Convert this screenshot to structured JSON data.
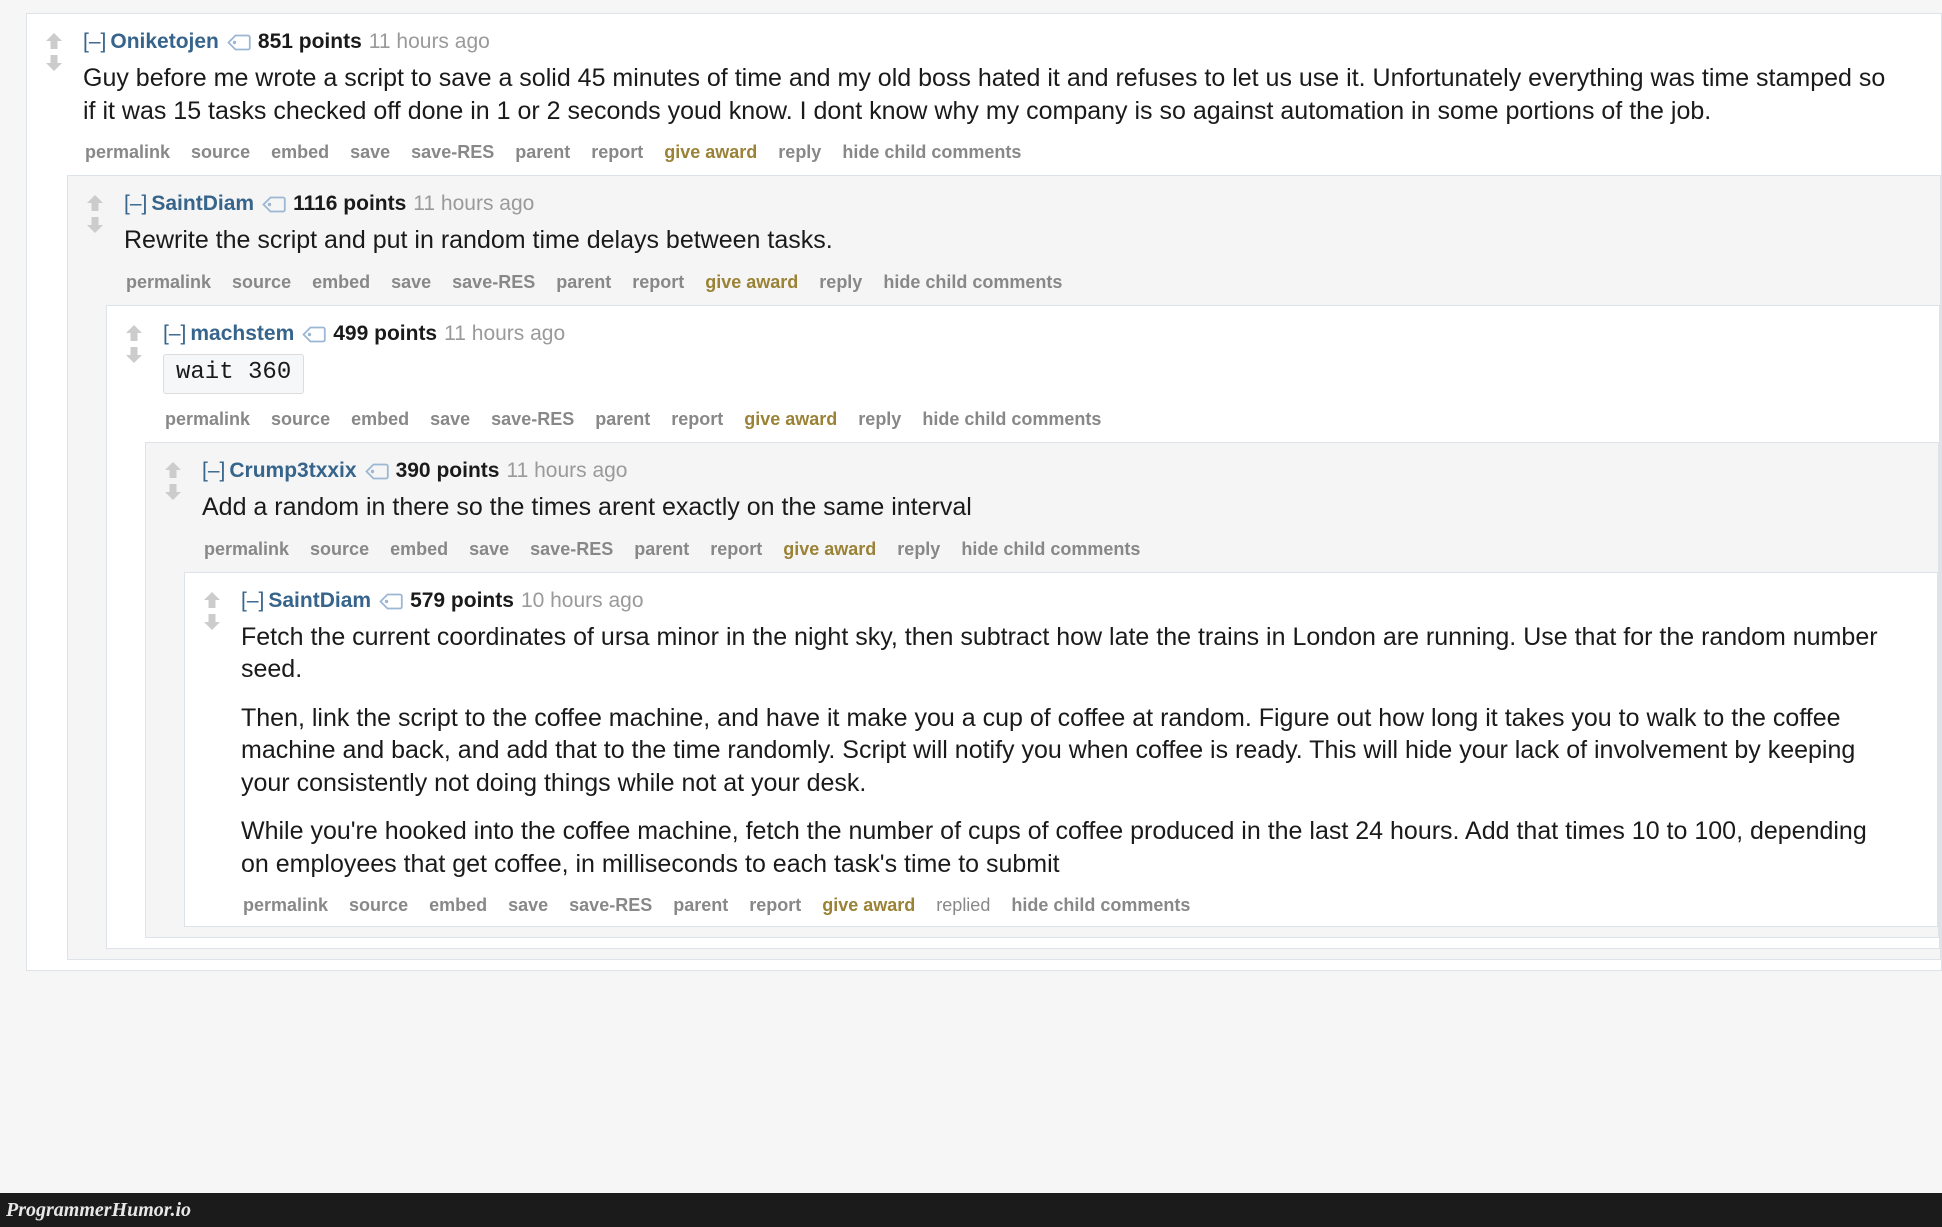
{
  "page": {
    "background": "#f6f6f6",
    "watermark": "ProgrammerHumor.io"
  },
  "colors": {
    "username": "#36648b",
    "points": "#1a1a1a",
    "age": "#9a9a9a",
    "action_link": "#888888",
    "give_award": "#9a8236",
    "border": "#dde3e8",
    "alt_background": "#f5f5f5",
    "code_background": "#f6f7f8",
    "arrow": "#cccccc",
    "tag_icon": "#9cb7d4"
  },
  "icons": {
    "upvote": "upvote-arrow-icon",
    "downvote": "downvote-arrow-icon",
    "tag": "comment-tag-icon",
    "collapse": "collapse-toggle-icon"
  },
  "action_labels": {
    "permalink": "permalink",
    "source": "source",
    "embed": "embed",
    "save": "save",
    "save_res": "save-RES",
    "parent": "parent",
    "report": "report",
    "give_award": "give award",
    "reply": "reply",
    "replied": "replied",
    "hide_child_comments": "hide child comments"
  },
  "comments": [
    {
      "level": 1,
      "collapse": "[–]",
      "username": "Oniketojen",
      "points": "851 points",
      "age": "11 hours ago",
      "paragraphs": [
        "Guy before me wrote a script to save a solid 45 minutes of time and my old boss hated it and refuses to let us use it. Unfortunately everything was time stamped so if it was 15 tasks checked off done in 1 or 2 seconds youd know. I dont know why my company is so against automation in some portions of the job."
      ],
      "code": null,
      "reply_label": "reply"
    },
    {
      "level": 2,
      "collapse": "[–]",
      "username": "SaintDiam",
      "points": "1116 points",
      "age": "11 hours ago",
      "paragraphs": [
        "Rewrite the script and put in random time delays between tasks."
      ],
      "code": null,
      "reply_label": "reply"
    },
    {
      "level": 3,
      "collapse": "[–]",
      "username": "machstem",
      "points": "499 points",
      "age": "11 hours ago",
      "paragraphs": [],
      "code": "wait 360",
      "reply_label": "reply"
    },
    {
      "level": 4,
      "collapse": "[–]",
      "username": "Crump3txxix",
      "points": "390 points",
      "age": "11 hours ago",
      "paragraphs": [
        "Add a random in there so the times arent exactly on the same interval"
      ],
      "code": null,
      "reply_label": "reply"
    },
    {
      "level": 5,
      "collapse": "[–]",
      "username": "SaintDiam",
      "points": "579 points",
      "age": "10 hours ago",
      "paragraphs": [
        "Fetch the current coordinates of ursa minor in the night sky, then subtract how late the trains in London are running. Use that for the random number seed.",
        "Then, link the script to the coffee machine, and have it make you a cup of coffee at random. Figure out how long it takes you to walk to the coffee machine and back, and add that to the time randomly. Script will notify you when coffee is ready. This will hide your lack of involvement by keeping your consistently not doing things while not at your desk.",
        "While you're hooked into the coffee machine, fetch the number of cups of coffee produced in the last 24 hours. Add that times 10 to 100, depending on employees that get coffee, in milliseconds to each task's time to submit"
      ],
      "code": null,
      "reply_label": "replied"
    }
  ]
}
